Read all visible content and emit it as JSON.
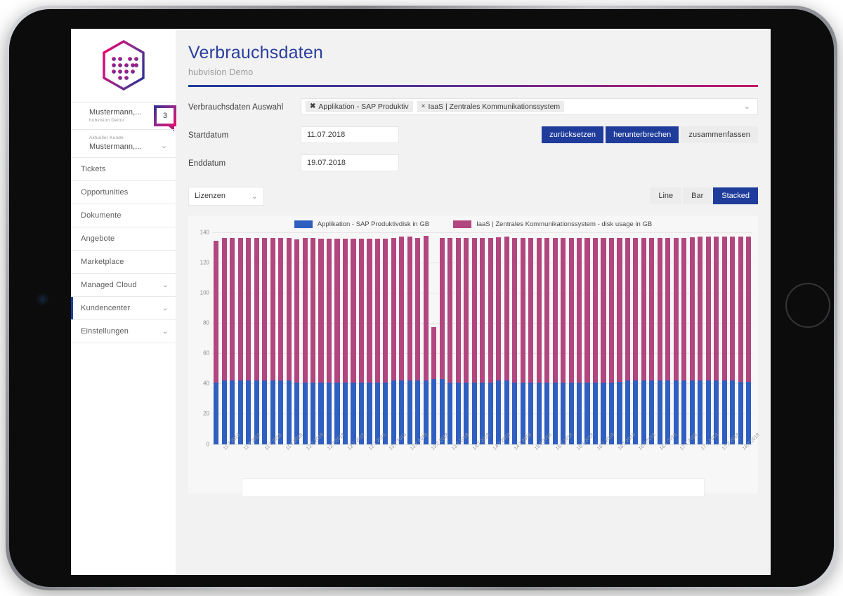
{
  "device": {
    "name": "tablet",
    "home_button": "home-button",
    "camera": "front-camera"
  },
  "branding": {
    "logo_name": "hubvision-hexagon-logo",
    "gradient_start": "#e6006e",
    "gradient_end": "#2e3192"
  },
  "sidebar": {
    "user": {
      "name": "Mustermann,...",
      "subtitle": "hubvision Demo",
      "badge_count": "3"
    },
    "customer": {
      "label": "Aktueller Kunde",
      "name": "Mustermann,...",
      "chevron": "chevron-down-icon"
    },
    "items": [
      {
        "label": "Tickets",
        "expandable": false,
        "active": false
      },
      {
        "label": "Opportunities",
        "expandable": false,
        "active": false
      },
      {
        "label": "Dokumente",
        "expandable": false,
        "active": false
      },
      {
        "label": "Angebote",
        "expandable": false,
        "active": false
      },
      {
        "label": "Marketplace",
        "expandable": false,
        "active": false
      },
      {
        "label": "Managed Cloud",
        "expandable": true,
        "active": false
      },
      {
        "label": "Kundencenter",
        "expandable": true,
        "active": true
      },
      {
        "label": "Einstellungen",
        "expandable": true,
        "active": false
      }
    ],
    "chevron_glyph": "⌄"
  },
  "header": {
    "title": "Verbrauchsdaten",
    "subtitle": "hubvision Demo",
    "rule_gradient": [
      "#1f3c9b",
      "#c2186a"
    ]
  },
  "form": {
    "selection_label": "Verbrauchsdaten Auswahl",
    "tokens": [
      {
        "remove": "✖",
        "label": "Applikation - SAP Produktiv",
        "bold": true
      },
      {
        "remove": "×",
        "label": "IaaS | Zentrales Kommunikationssystem",
        "bold": false
      }
    ],
    "dropdown_caret": "chevron-down-icon",
    "start_label": "Startdatum",
    "start_value": "11.07.2018",
    "end_label": "Enddatum",
    "end_value": "19.07.2018",
    "buttons": [
      {
        "label": "zurücksetzen",
        "style": "primary"
      },
      {
        "label": "herunterbrechen",
        "style": "primary"
      },
      {
        "label": "zusammenfassen",
        "style": "ghost"
      }
    ],
    "unit_select": {
      "value": "Lizenzen",
      "caret": "chevron-down-icon"
    },
    "chart_types": [
      {
        "label": "Line",
        "active": false
      },
      {
        "label": "Bar",
        "active": false
      },
      {
        "label": "Stacked",
        "active": true
      }
    ]
  },
  "chart_data": {
    "type": "bar",
    "stacked": true,
    "title": "",
    "xlabel": "",
    "ylabel": "",
    "ylim": [
      0,
      140
    ],
    "yticks": [
      0,
      20,
      40,
      60,
      80,
      100,
      120,
      140
    ],
    "grid": true,
    "legend_position": "top-center",
    "colors": {
      "series1": "#2f5fc0",
      "series2": "#b2467e"
    },
    "series": [
      {
        "name": "Applikation - SAP Produktivdisk in GB",
        "color": "#2f5fc0",
        "values": [
          40.5,
          42,
          42,
          42,
          42,
          42,
          42,
          42,
          42,
          42,
          40.5,
          40.5,
          40.5,
          40.5,
          40.5,
          40.5,
          40.5,
          40.5,
          40.5,
          40.5,
          40.5,
          40.5,
          42,
          42,
          42,
          42,
          42,
          43,
          43,
          40.5,
          40.5,
          40.5,
          40.5,
          40.5,
          40.5,
          42,
          42,
          40.5,
          40.5,
          40.5,
          40.5,
          40.5,
          40.5,
          40.5,
          40.5,
          40.5,
          40.5,
          40.5,
          40.5,
          40.5,
          41,
          42,
          42,
          42,
          42,
          42,
          42,
          42,
          42,
          42,
          42,
          42,
          42,
          42,
          42,
          41,
          41
        ]
      },
      {
        "name": "IaaS | Zentrales Kommunikationssystem - disk usage in GB",
        "color": "#b2467e",
        "values": [
          93.5,
          94,
          94,
          94,
          94,
          94,
          94,
          94,
          94,
          94,
          94.5,
          95.5,
          95.5,
          95,
          95,
          95,
          95,
          95,
          95,
          95,
          95,
          95,
          94,
          95,
          95,
          94,
          95.5,
          34,
          93,
          95.5,
          95.5,
          95.5,
          95.5,
          95.5,
          95.5,
          94.5,
          95,
          95.5,
          95.5,
          95.5,
          95.5,
          95.5,
          95.5,
          95.5,
          95.5,
          95.5,
          95.5,
          95.5,
          95.5,
          95.5,
          95,
          94,
          94,
          94,
          94,
          94,
          94,
          94,
          94,
          94.5,
          95,
          95,
          95,
          95,
          95,
          96,
          96
        ]
      }
    ],
    "categories": [
      "11.7.2018",
      "11.7.2018",
      "11.7.2018",
      "11.7.2018",
      "11.7.2018",
      "12.7.2018",
      "12.7.2018",
      "12.7.2018",
      "12.7.2018",
      "12.7.2018",
      "12.7.2018",
      "12.7.2018",
      "12.7.2018",
      "13.7.2018",
      "13.7.2018",
      "13.7.2018",
      "13.7.2018",
      "13.7.2018",
      "13.7.2018",
      "13.7.2018",
      "13.7.2018",
      "13.7.2018",
      "13.7.2018",
      "13.7.2018",
      "13.7.2018",
      "13.7.2018",
      "13.7.2018",
      "13.7.2018",
      "14.7.2018",
      "14.7.2018",
      "14.7.2018",
      "14.7.2018",
      "14.7.2018",
      "14.7.2018",
      "14.7.2018",
      "14.7.2018",
      "15.7.2018",
      "15.7.2018",
      "15.7.2018",
      "15.7.2018",
      "15.7.2018",
      "15.7.2018",
      "15.7.2018",
      "16.7.2018",
      "16.7.2018",
      "16.7.2018",
      "16.7.2018",
      "16.7.2018",
      "16.7.2018",
      "16.7.2018",
      "16.7.2018",
      "16.7.2018",
      "16.7.2018",
      "16.7.2018",
      "16.7.2018",
      "16.7.2018",
      "17.7.2018",
      "17.7.2018",
      "17.7.2018",
      "17.7.2018",
      "17.7.2018",
      "17.7.2018",
      "17.7.2018",
      "18.7.2018",
      "18.7.2018",
      "18.7.2018",
      "18.7.2018"
    ],
    "xtick_labels": [
      "11.7.2018",
      "11.7.2018",
      "11.7.2018",
      "11.7.2018",
      "12.7.2018",
      "12.7.2018",
      "12.7.2018",
      "12.7.2018",
      "13.7.2018",
      "13.7.2018",
      "13.7.2018",
      "13.7.2018",
      "14.7.2018",
      "14.7.2018",
      "14.7.2018",
      "15.7.2018",
      "15.7.2018",
      "15.7.2018",
      "16.7.2018",
      "16.7.2018",
      "16.7.2018",
      "16.7.2018",
      "17.7.2018",
      "17.7.2018",
      "17.7.2018",
      "18.7.2018"
    ]
  },
  "range_selector": {
    "name": "chart-range-selector"
  }
}
